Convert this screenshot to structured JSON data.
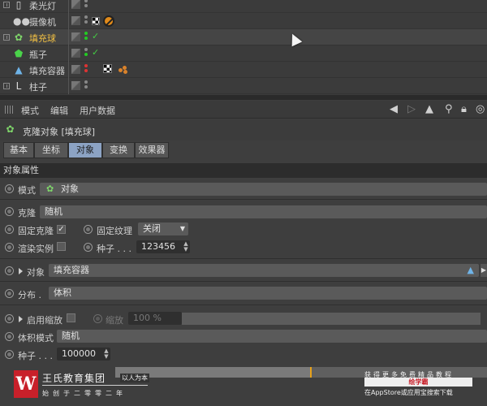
{
  "objects": [
    {
      "name": "柔光灯",
      "icon": "light-icon",
      "selected": false
    },
    {
      "name": "摄像机",
      "icon": "camera-icon",
      "selected": false
    },
    {
      "name": "填充球",
      "icon": "cloner-icon",
      "selected": true
    },
    {
      "name": "瓶子",
      "icon": "bottle-icon",
      "selected": false
    },
    {
      "name": "填充容器",
      "icon": "container-icon",
      "selected": false
    },
    {
      "name": "柱子",
      "icon": "null-icon",
      "selected": false
    }
  ],
  "menu": {
    "mode": "模式",
    "edit": "编辑",
    "userdata": "用户数据"
  },
  "panel": {
    "title": "克隆对象 [填充球]"
  },
  "tabs": [
    "基本",
    "坐标",
    "对象",
    "变换",
    "效果器"
  ],
  "active_tab": "对象",
  "group": {
    "title": "对象属性"
  },
  "params": {
    "mode_label": "模式",
    "mode_value": "对象",
    "clone_label": "克隆",
    "clone_value": "随机",
    "fix_clone_label": "固定克隆",
    "fix_clone_checked": "✓",
    "fix_texture_label": "固定纹理",
    "fix_texture_value": "关闭",
    "render_instance_label": "渲染实例",
    "seed_label": "种子 . . .",
    "seed_value": "123456",
    "object_label": "对象",
    "object_value": "填充容器",
    "distribution_label": "分布 .",
    "distribution_value": "体积",
    "enable_scale_label": "启用缩放",
    "scale_label": "缩放",
    "scale_value": "100 %",
    "volume_mode_label": "体积模式",
    "volume_mode_value": "随机",
    "seed2_label": "种子 . . .",
    "seed2_value": "100000"
  },
  "watermark": {
    "logo": "W",
    "name": "王氏教育集团",
    "slogan": "以人为本",
    "sub": "始创于二零零二年",
    "right1": "获得更多免费精品教程",
    "right2": "绘学霸",
    "right3": "在AppStore或应用宝搜索下载"
  }
}
